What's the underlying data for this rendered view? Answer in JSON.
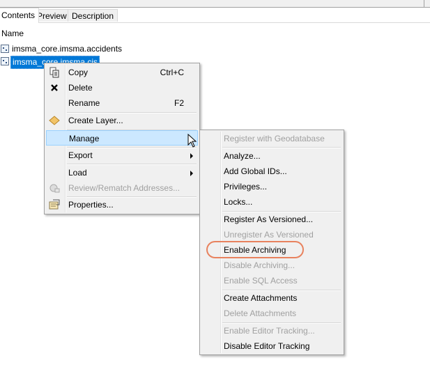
{
  "tabs": [
    "Contents",
    "Preview",
    "Description"
  ],
  "column_header": "Name",
  "items": [
    "imsma_core.imsma.accidents",
    "imsma_core.imsma.cis"
  ],
  "context_menu": {
    "copy": "Copy",
    "copy_shortcut": "Ctrl+C",
    "delete": "Delete",
    "rename": "Rename",
    "rename_shortcut": "F2",
    "create_layer": "Create Layer...",
    "manage": "Manage",
    "export": "Export",
    "load": "Load",
    "review": "Review/Rematch Addresses...",
    "properties": "Properties..."
  },
  "submenu": {
    "register_gdb": "Register with Geodatabase",
    "analyze": "Analyze...",
    "add_global_ids": "Add Global IDs...",
    "privileges": "Privileges...",
    "locks": "Locks...",
    "register_versioned": "Register As Versioned...",
    "unregister_versioned": "Unregister As Versioned",
    "enable_archiving": "Enable Archiving",
    "disable_archiving": "Disable Archiving...",
    "enable_sql": "Enable SQL Access",
    "create_attachments": "Create Attachments",
    "delete_attachments": "Delete Attachments",
    "enable_editor_tracking": "Enable Editor Tracking...",
    "disable_editor_tracking": "Disable Editor Tracking"
  },
  "colors": {
    "selection": "#0078d7",
    "menu_highlight": "#cce8ff",
    "callout": "#e8825e",
    "disabled_text": "#a0a0a0"
  }
}
